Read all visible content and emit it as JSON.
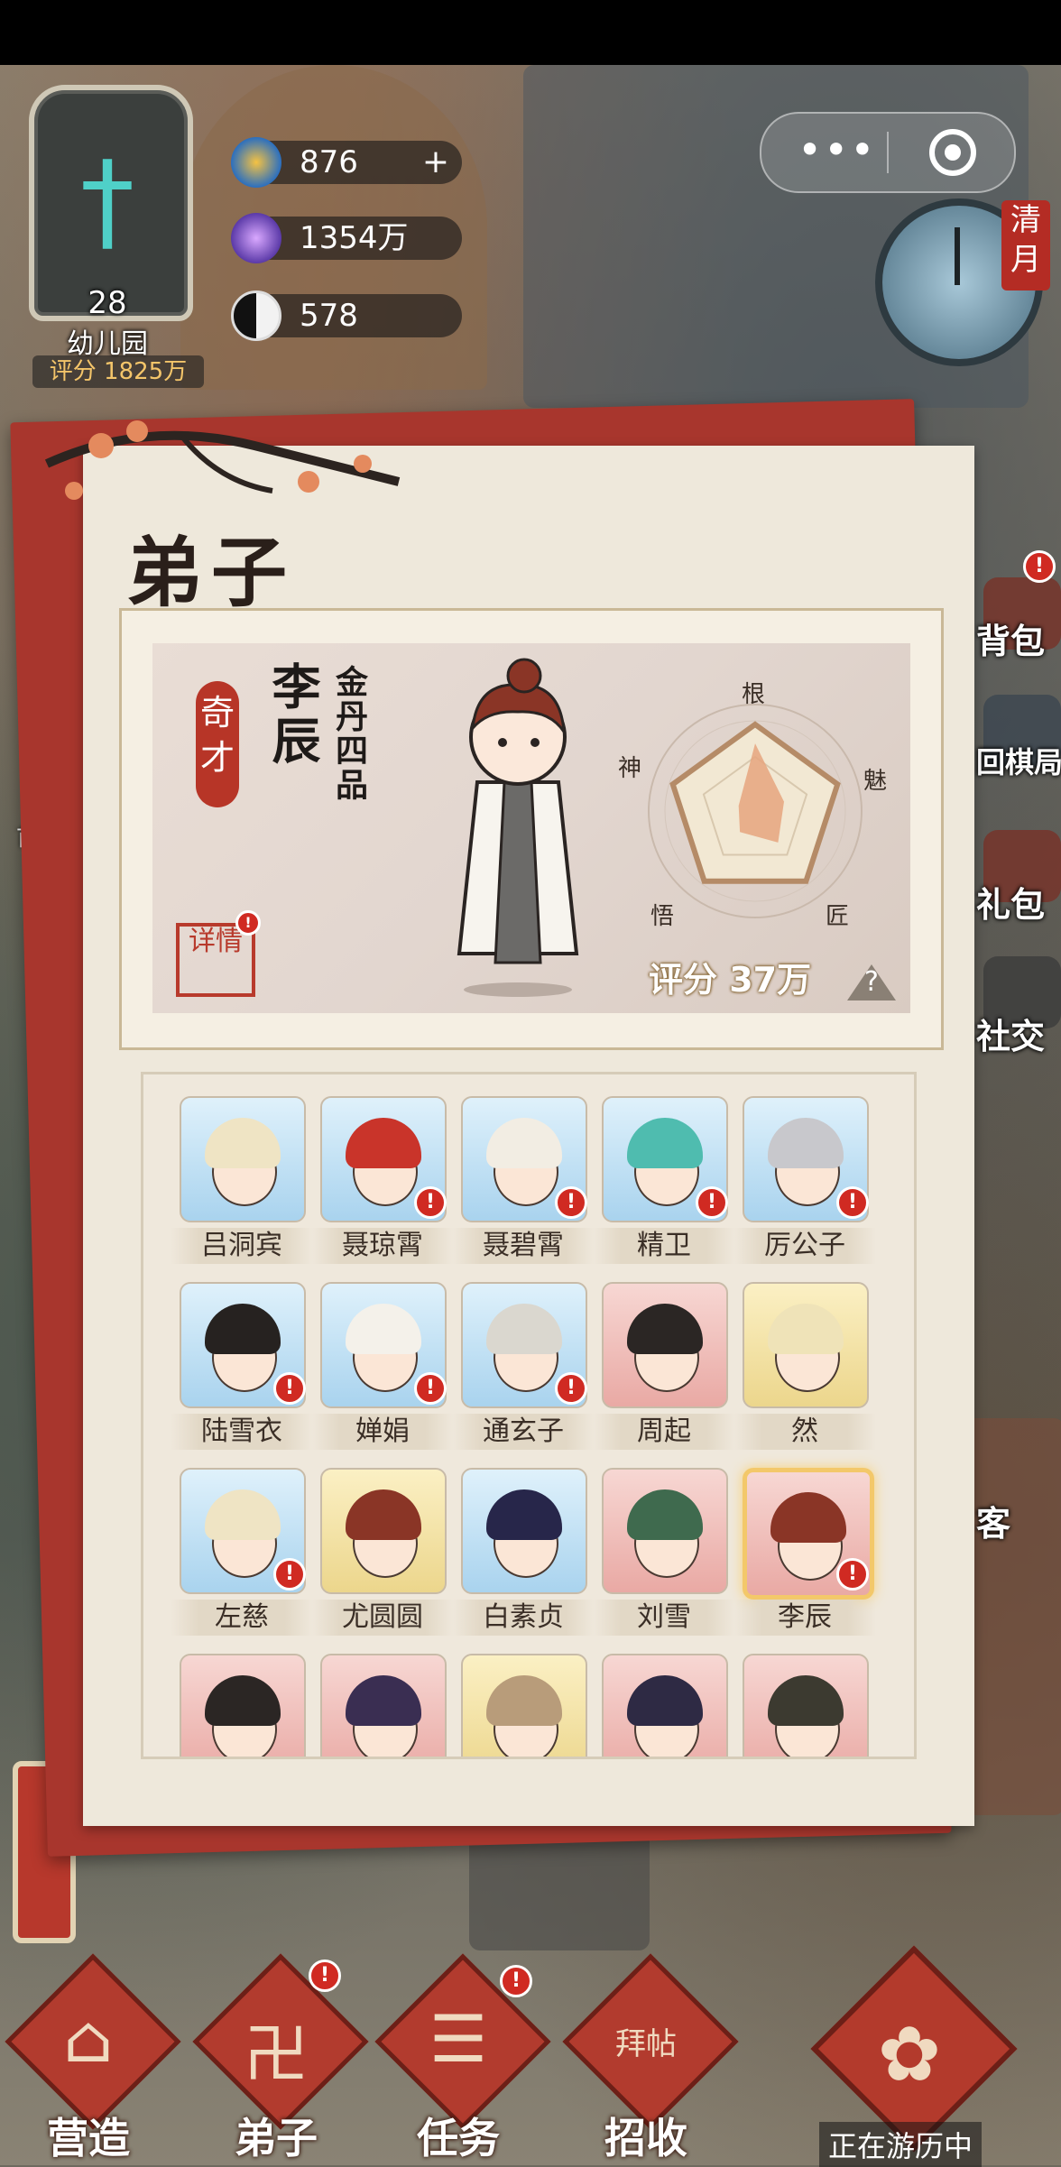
{
  "resources": {
    "coins": {
      "value": "876",
      "plus": "+"
    },
    "crystals": {
      "value": "1354万"
    },
    "yinyang": {
      "value": "578"
    }
  },
  "sect": {
    "level": "28",
    "name": "幼儿园",
    "score": "评分 1825万"
  },
  "capsule": {
    "more": "•••"
  },
  "calendar": {
    "month": "清月"
  },
  "side_menu": [
    "背包",
    "回棋局",
    "礼包",
    "社交",
    "客"
  ],
  "side_left": {
    "home": "首"
  },
  "panel": {
    "title": "弟子",
    "selected": {
      "talent": "奇才",
      "name": "李辰",
      "rank": "金丹四品",
      "detail_label": "详情",
      "score": "评分 37万",
      "help": "?",
      "stats": {
        "root": "根",
        "charm": "魅",
        "craft": "匠",
        "insight": "悟",
        "spirit": "神"
      },
      "stat_values": {
        "root": 0.78,
        "charm": 0.35,
        "craft": 0.45,
        "insight": 0.3,
        "spirit": 0.2
      }
    }
  },
  "roster": [
    {
      "name": "吕洞宾",
      "tier": "blue",
      "hair": "#efe4c4",
      "alert": false
    },
    {
      "name": "聂琼霄",
      "tier": "blue",
      "hair": "#c9342a",
      "alert": true
    },
    {
      "name": "聂碧霄",
      "tier": "blue",
      "hair": "#f2ede3",
      "alert": true
    },
    {
      "name": "精卫",
      "tier": "blue",
      "hair": "#4fbcaf",
      "alert": true
    },
    {
      "name": "厉公子",
      "tier": "blue",
      "hair": "#c8c8cc",
      "alert": true
    },
    {
      "name": "陆雪衣",
      "tier": "blue",
      "hair": "#262220",
      "alert": true
    },
    {
      "name": "婵娟",
      "tier": "blue",
      "hair": "#f4f1ea",
      "alert": true
    },
    {
      "name": "通玄子",
      "tier": "blue",
      "hair": "#dad7cf",
      "alert": true
    },
    {
      "name": "周起",
      "tier": "pink",
      "hair": "#2b2624",
      "alert": false
    },
    {
      "name": "然",
      "tier": "gold",
      "hair": "#efe3b8",
      "alert": false
    },
    {
      "name": "左慈",
      "tier": "blue",
      "hair": "#efe4c4",
      "alert": true
    },
    {
      "name": "尤圆圆",
      "tier": "gold",
      "hair": "#8a3526",
      "alert": false
    },
    {
      "name": "白素贞",
      "tier": "blue",
      "hair": "#27264a",
      "alert": false
    },
    {
      "name": "刘雪",
      "tier": "pink",
      "hair": "#3f6a4e",
      "alert": false
    },
    {
      "name": "李辰",
      "tier": "pink",
      "hair": "#8a3526",
      "alert": true,
      "selected": true
    },
    {
      "name": "",
      "tier": "pink",
      "hair": "#2b2624",
      "alert": false
    },
    {
      "name": "",
      "tier": "pink",
      "hair": "#3a2e52",
      "alert": false
    },
    {
      "name": "",
      "tier": "gold",
      "hair": "#b89c7a",
      "alert": false
    },
    {
      "name": "",
      "tier": "pink",
      "hair": "#2e2a44",
      "alert": false
    },
    {
      "name": "",
      "tier": "pink",
      "hair": "#3c3a30",
      "alert": false
    }
  ],
  "bottom_nav": [
    {
      "label": "营造",
      "glyph": "⌂",
      "alert": false
    },
    {
      "label": "弟子",
      "glyph": "卍",
      "alert": true
    },
    {
      "label": "任务",
      "glyph": "☰",
      "alert": true
    },
    {
      "label": "招收",
      "glyph": "拜帖",
      "alert": false
    }
  ],
  "travel": {
    "glyph": "✿",
    "label": "正在游历中"
  },
  "colors": {
    "accent_red": "#b23b2e",
    "score_gold": "#f4c56a",
    "panel_bg": "#eee8db"
  }
}
